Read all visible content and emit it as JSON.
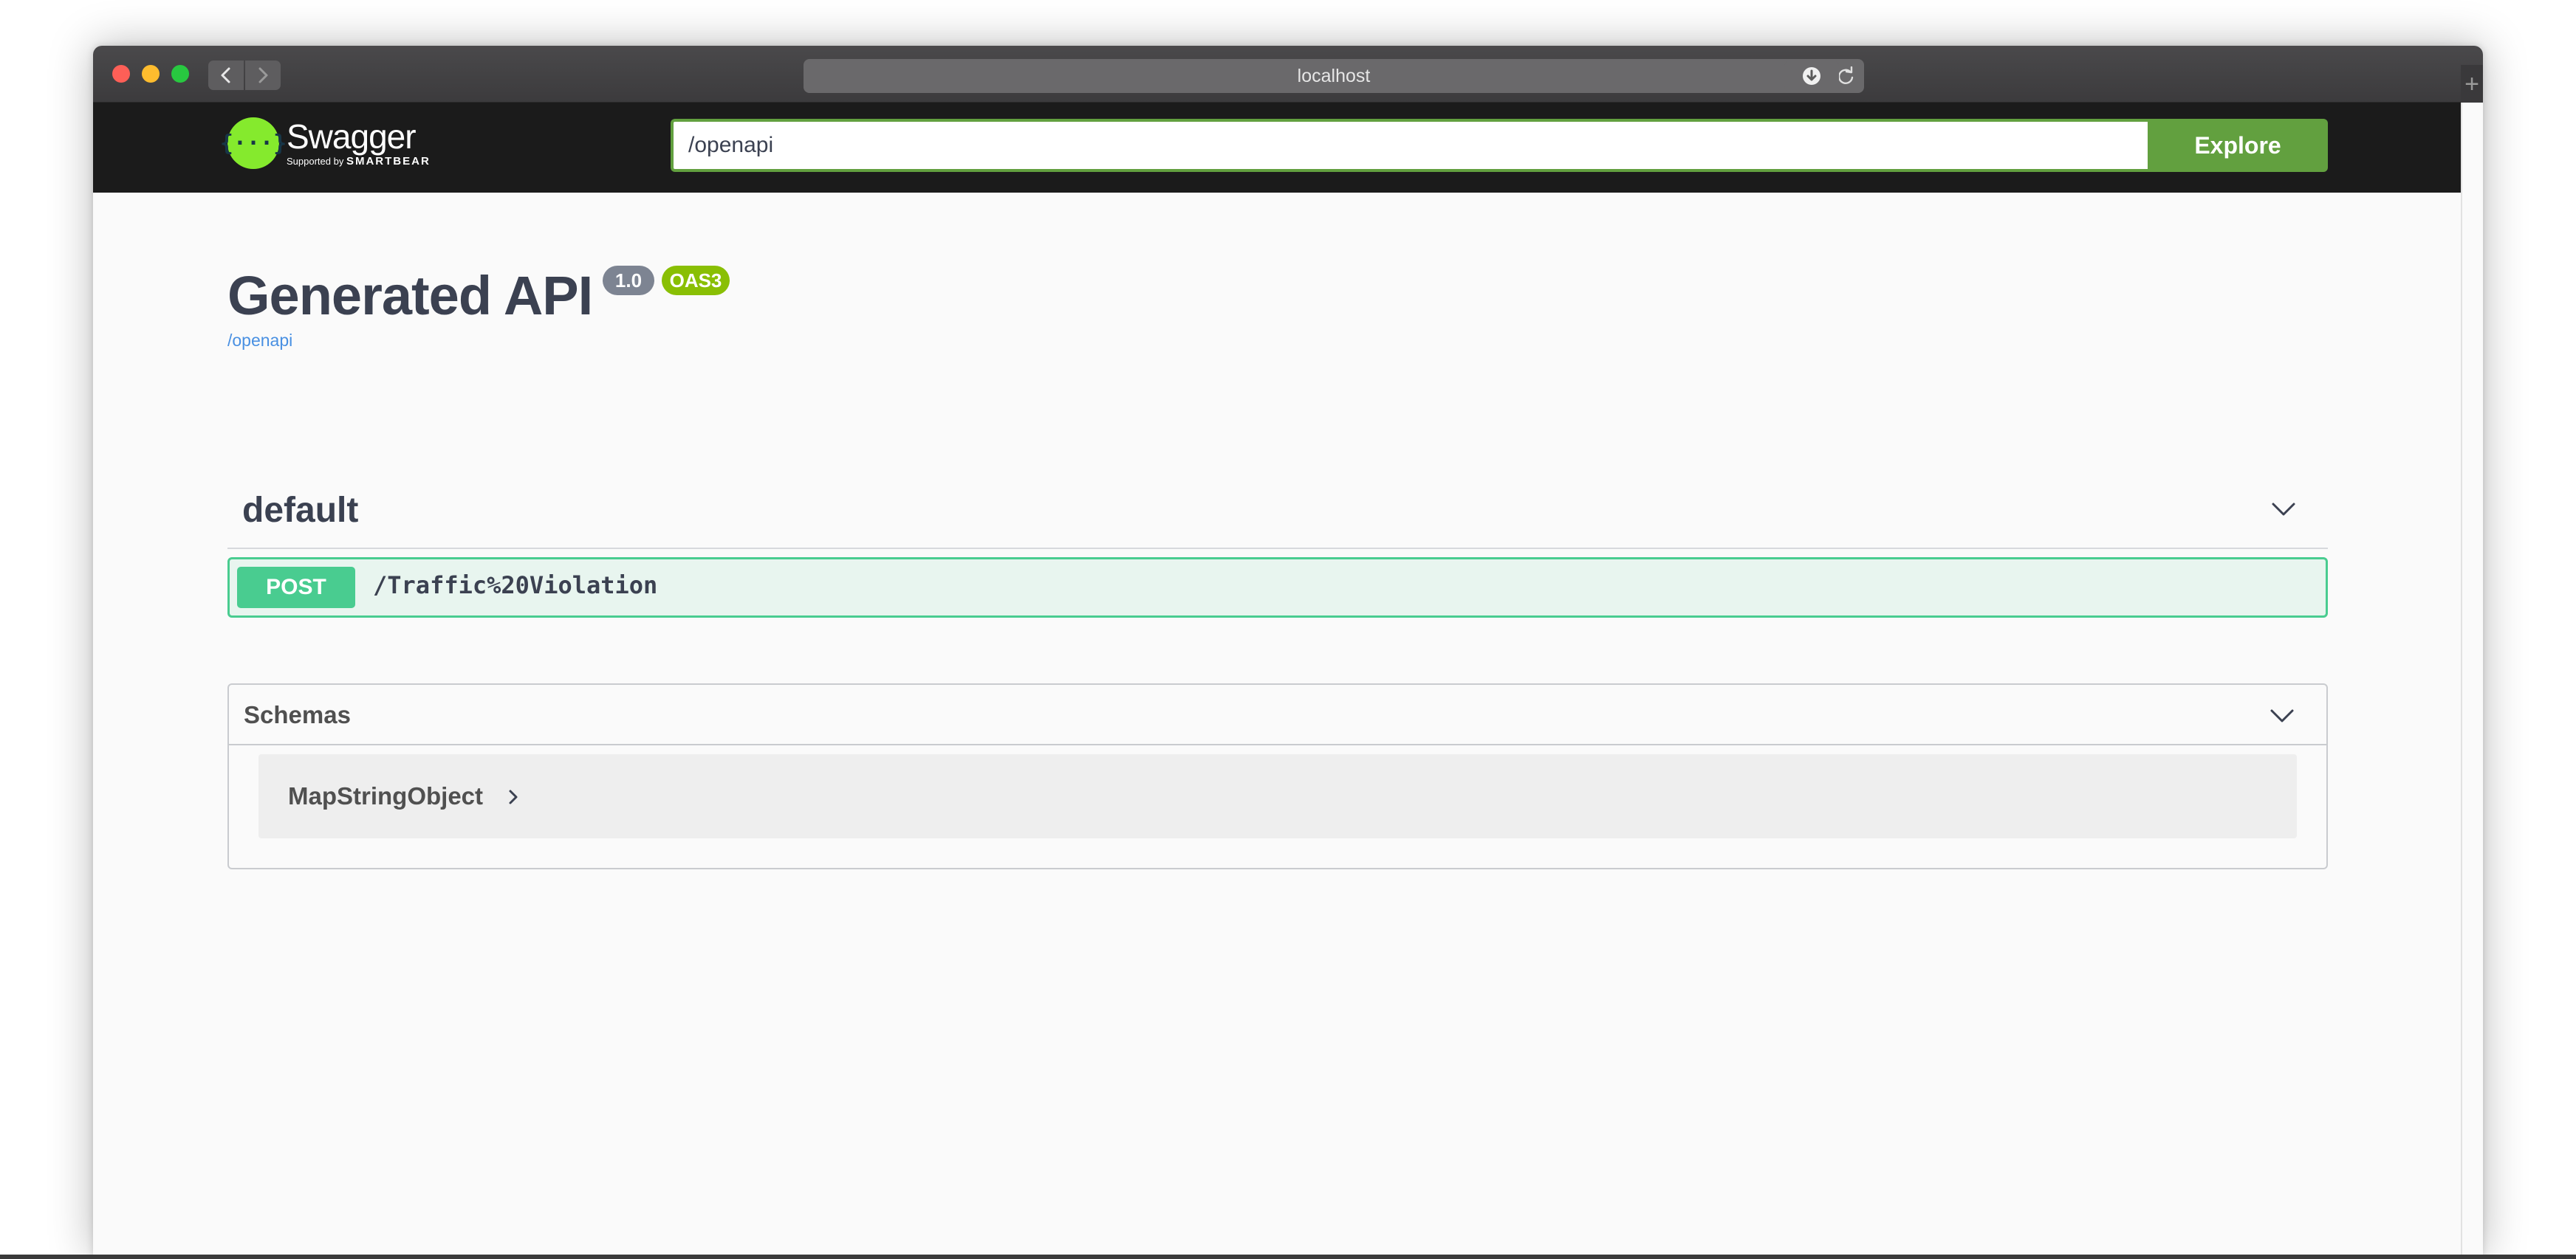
{
  "browser": {
    "url": "localhost",
    "new_tab_symbol": "+"
  },
  "topbar": {
    "logo_symbol": "{···}",
    "logo_name": "Swagger",
    "logo_sub_prefix": "Supported by",
    "logo_sub_brand": "SMARTBEAR",
    "search_value": "/openapi",
    "explore_label": "Explore"
  },
  "info": {
    "title": "Generated API",
    "version": "1.0",
    "oas": "OAS3",
    "link": "/openapi"
  },
  "tags": [
    {
      "name": "default",
      "operations": [
        {
          "method": "POST",
          "path": "/Traffic%20Violation"
        }
      ]
    }
  ],
  "models": {
    "title": "Schemas",
    "items": [
      {
        "name": "MapStringObject"
      }
    ]
  },
  "colors": {
    "topbar_bg": "#1b1b1b",
    "accent_green": "#62a03f",
    "post_green": "#49cc90",
    "oas_badge": "#89bf04",
    "version_badge": "#7d8492",
    "link_blue": "#4990e2"
  }
}
